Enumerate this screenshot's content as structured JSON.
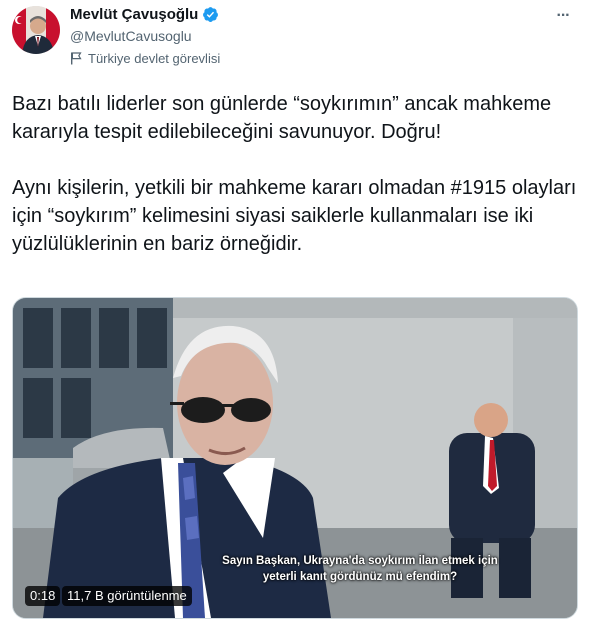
{
  "author": {
    "name": "Mevlüt Çavuşoğlu",
    "handle": "@MevlutCavusoglu",
    "label": "Türkiye devlet görevlisi",
    "verified_icon": "verified-badge",
    "label_icon": "flag-icon"
  },
  "menu": {
    "icon": "more-horizontal-icon",
    "glyph": "···"
  },
  "tweet": {
    "paragraph1": "Bazı batılı liderler son günlerde “soykırımın” ancak mahkeme kararıyla tespit edilebileceğini savunuyor. Doğru!",
    "paragraph2": "Aynı kişilerin, yetkili bir mahkeme kararı olmadan #1915 olayları için “soykırım” kelimesini siyasi saiklerle kullanmaları ise iki yüzlülüklerinin en bariz örneğidir."
  },
  "media": {
    "subtitle_line1": "Sayın Başkan, Ukrayna'da soykırım ilan etmek için",
    "subtitle_line2": "yeterli kanıt gördünüz mü efendim?",
    "duration": "0:18",
    "views": "11,7 B görüntülenme"
  },
  "colors": {
    "verified": "#1d9bf0",
    "text": "#0f1419",
    "secondary": "#536471"
  }
}
